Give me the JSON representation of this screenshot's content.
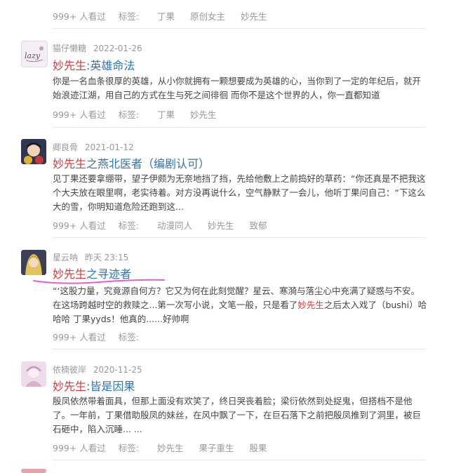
{
  "entries": [
    {
      "views": "999+ 人看过",
      "tags_label": "标签:",
      "tags": [
        "丁果",
        "原创女主",
        "妙先生"
      ]
    },
    {
      "author": "猫仔懒糖",
      "date": "2022-01-26",
      "title_keyword": "妙先生",
      "title_rest": ":英雄命法",
      "excerpt": "你是一名血条很厚的英雄，从小你就拥有一颗想要成为英雄的心，当你到了一定的年纪后，就开始浪迹江湖，用自己的方式在生与死之间徘徊 而你不是这个世界的人，你一直都知道",
      "views": "999+ 人看过",
      "tags_label": "标签:",
      "tags": [
        "丁果",
        "妙先生"
      ],
      "avatar_text": "lazy",
      "avatar_icon": "lazy-cat-icon"
    },
    {
      "author": "卿良骨",
      "date": "2021-01-12",
      "title_keyword": "妙先生",
      "title_rest": "之燕北医者（编剧认可）",
      "excerpt": "见丁果还要拿绷带，望子伊颇为无奈地挡了挡，先给他敷上之前捣好的草药：“你还真是不把我这个大夫放在眼里啊，老实待着。对方没再说什么，空气静默了一会儿，他听丁果问自己：“下这么大的雪，你明知道危险还跑到这...",
      "views": "999+ 人看过",
      "tags_label": "标签:",
      "tags": [
        "动漫同人",
        "妙先生",
        "致郁"
      ],
      "avatar_icon": "anime-character-icon"
    },
    {
      "author": "星云呐",
      "date": "昨天 23:15",
      "title_keyword": "妙先生",
      "title_rest": "之寻迹者",
      "excerpt_before": "“‘这股力量，究竟源自何方？它又为何在此刻觉醒？星云、寒漪与落尘心中充满了疑惑与不安。在这场跨越时空的救赎之...第一次写小说，文笔一般，只是看了",
      "excerpt_highlight": "妙先生",
      "excerpt_after": "之后太入戏了（bushi）哈哈哈 丁果yyds！他真的......好帅啊",
      "views": "999+ 人看过",
      "tags_label": "标签:",
      "tags": [],
      "avatar_icon": "blonde-character-icon",
      "underline_color": "#e060d0"
    },
    {
      "author": "依楠彼岸",
      "date": "2020-11-25",
      "title_keyword": "妙先生",
      "title_rest": ":皆是因果",
      "excerpt": "殷凤依然带着面具，但那上面没有欢笑了，终日哭丧着脸；梁衍依然到处捉鬼，但搭档不是他了。一年前，丁果借助殷凤的妹丝，在风中飘了一下，在巨石落下之前把殷凤推到了洞里，被巨石砸中，陷入沉睡... ...",
      "views": "999+ 人看过",
      "tags_label": "标签:",
      "tags": [
        "妙先生",
        "果子重生",
        "殷果"
      ],
      "avatar_icon": "pink-portrait-icon"
    }
  ],
  "colors": {
    "keyword": "#d23b3b",
    "title": "#2c74b3",
    "meta": "#999999",
    "divider": "#e6e6e6"
  }
}
